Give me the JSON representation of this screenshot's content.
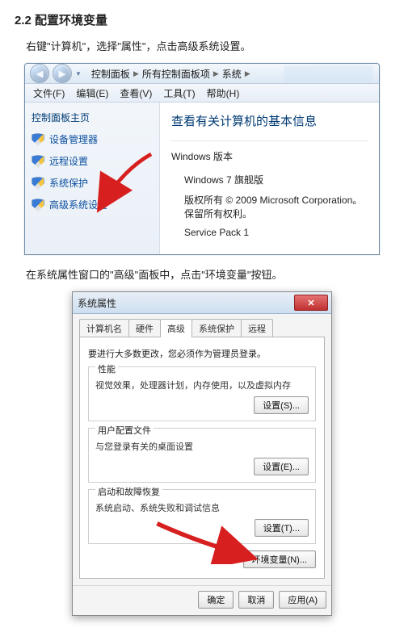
{
  "heading": "2.2 配置环境变量",
  "para1": "右键\"计算机\"，选择\"属性\"，点击高级系统设置。",
  "para2": "在系统属性窗口的\"高级\"面板中，点击\"环境变量\"按钮。",
  "win1": {
    "crumb": {
      "lv1": "控制面板",
      "lv2": "所有控制面板项",
      "lv3": "系统"
    },
    "menus": [
      "文件(F)",
      "编辑(E)",
      "查看(V)",
      "工具(T)",
      "帮助(H)"
    ],
    "side_title": "控制面板主页",
    "side_links": [
      "设备管理器",
      "远程设置",
      "系统保护",
      "高级系统设置"
    ],
    "main_head": "查看有关计算机的基本信息",
    "section_label": "Windows 版本",
    "edition": "Windows 7 旗舰版",
    "copyright": "版权所有 © 2009 Microsoft Corporation。保留所有权利。",
    "sp": "Service Pack 1"
  },
  "dlg": {
    "title": "系统属性",
    "tabs": [
      "计算机名",
      "硬件",
      "高级",
      "系统保护",
      "远程"
    ],
    "active_tab_index": 2,
    "admin_note": "要进行大多数更改，您必须作为管理员登录。",
    "groups": [
      {
        "legend": "性能",
        "text": "视觉效果，处理器计划，内存使用，以及虚拟内存",
        "btn": "设置(S)..."
      },
      {
        "legend": "用户配置文件",
        "text": "与您登录有关的桌面设置",
        "btn": "设置(E)..."
      },
      {
        "legend": "启动和故障恢复",
        "text": "系统启动、系统失败和调试信息",
        "btn": "设置(T)..."
      }
    ],
    "env_btn": "环境变量(N)...",
    "footer": [
      "确定",
      "取消",
      "应用(A)"
    ]
  }
}
